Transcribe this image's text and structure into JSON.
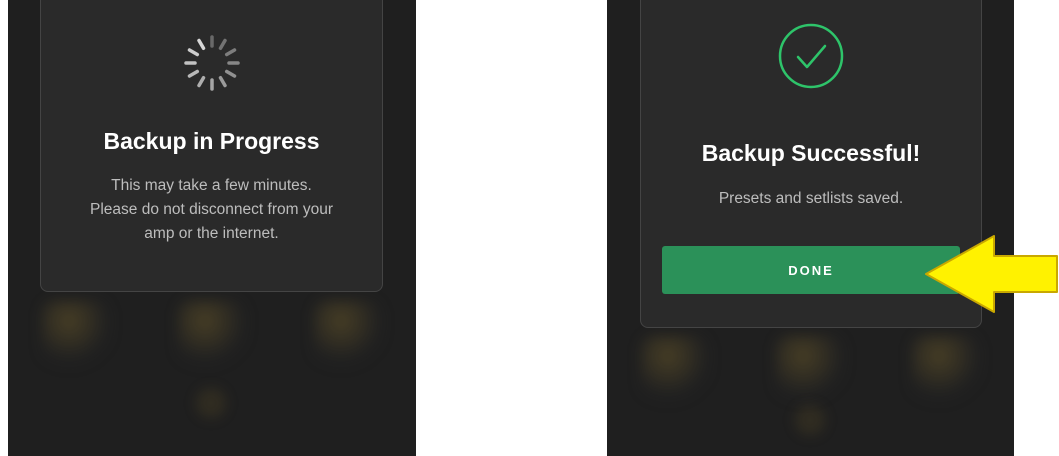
{
  "left_screen": {
    "spinner_icon": "loading-spinner-icon",
    "title": "Backup in Progress",
    "body_lines": [
      "This may take a few minutes.",
      "Please do not disconnect from your",
      "amp or the internet."
    ]
  },
  "right_screen": {
    "status_icon": "checkmark-circle-icon",
    "title": "Backup Successful!",
    "body_lines": [
      "Presets and setlists saved."
    ],
    "done_button_label": "DONE"
  },
  "annotation": {
    "icon": "yellow-arrow-icon",
    "points_to": "done-button"
  },
  "colors": {
    "background": "#1f1f1f",
    "modal": "#2a2a2a",
    "accent_green": "#2b9159",
    "check_green": "#2ec46a",
    "arrow_yellow": "#fff200"
  }
}
